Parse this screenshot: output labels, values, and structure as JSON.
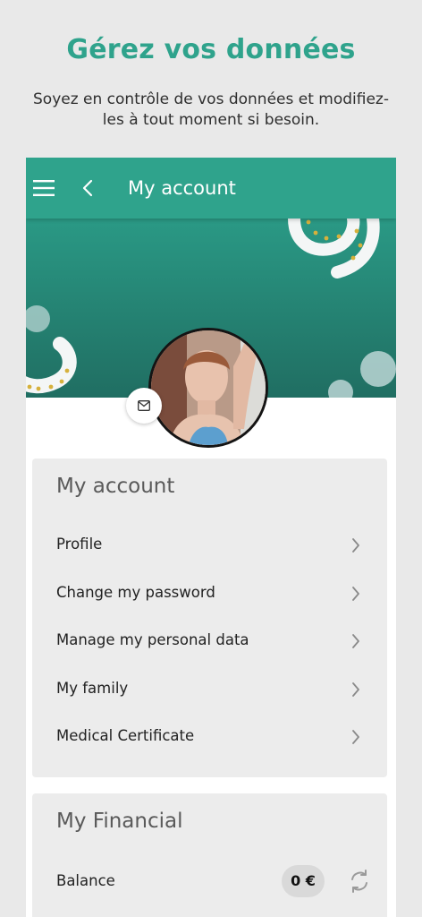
{
  "promo": {
    "title": "Gérez vos données",
    "subtitle": "Soyez en contrôle de vos données et modifiez-les à tout moment si besoin."
  },
  "topbar": {
    "title": "My account",
    "menu_icon": "menu-icon",
    "back_icon": "chevron-left-icon"
  },
  "profile": {
    "avatar_icon": "avatar",
    "mail_icon": "mail-icon"
  },
  "account_card": {
    "title": "My account",
    "items": [
      {
        "label": "Profile"
      },
      {
        "label": "Change my password"
      },
      {
        "label": "Manage my personal data"
      },
      {
        "label": "My family"
      },
      {
        "label": "Medical Certificate"
      }
    ]
  },
  "financial_card": {
    "title": "My Financial",
    "balance_label": "Balance",
    "balance_value": "0 €",
    "refresh_icon": "refresh-icon"
  },
  "colors": {
    "brand": "#2fa38c",
    "banner_dark": "#206e62",
    "card_bg": "#ececec",
    "page_bg": "#e9e9e9"
  }
}
